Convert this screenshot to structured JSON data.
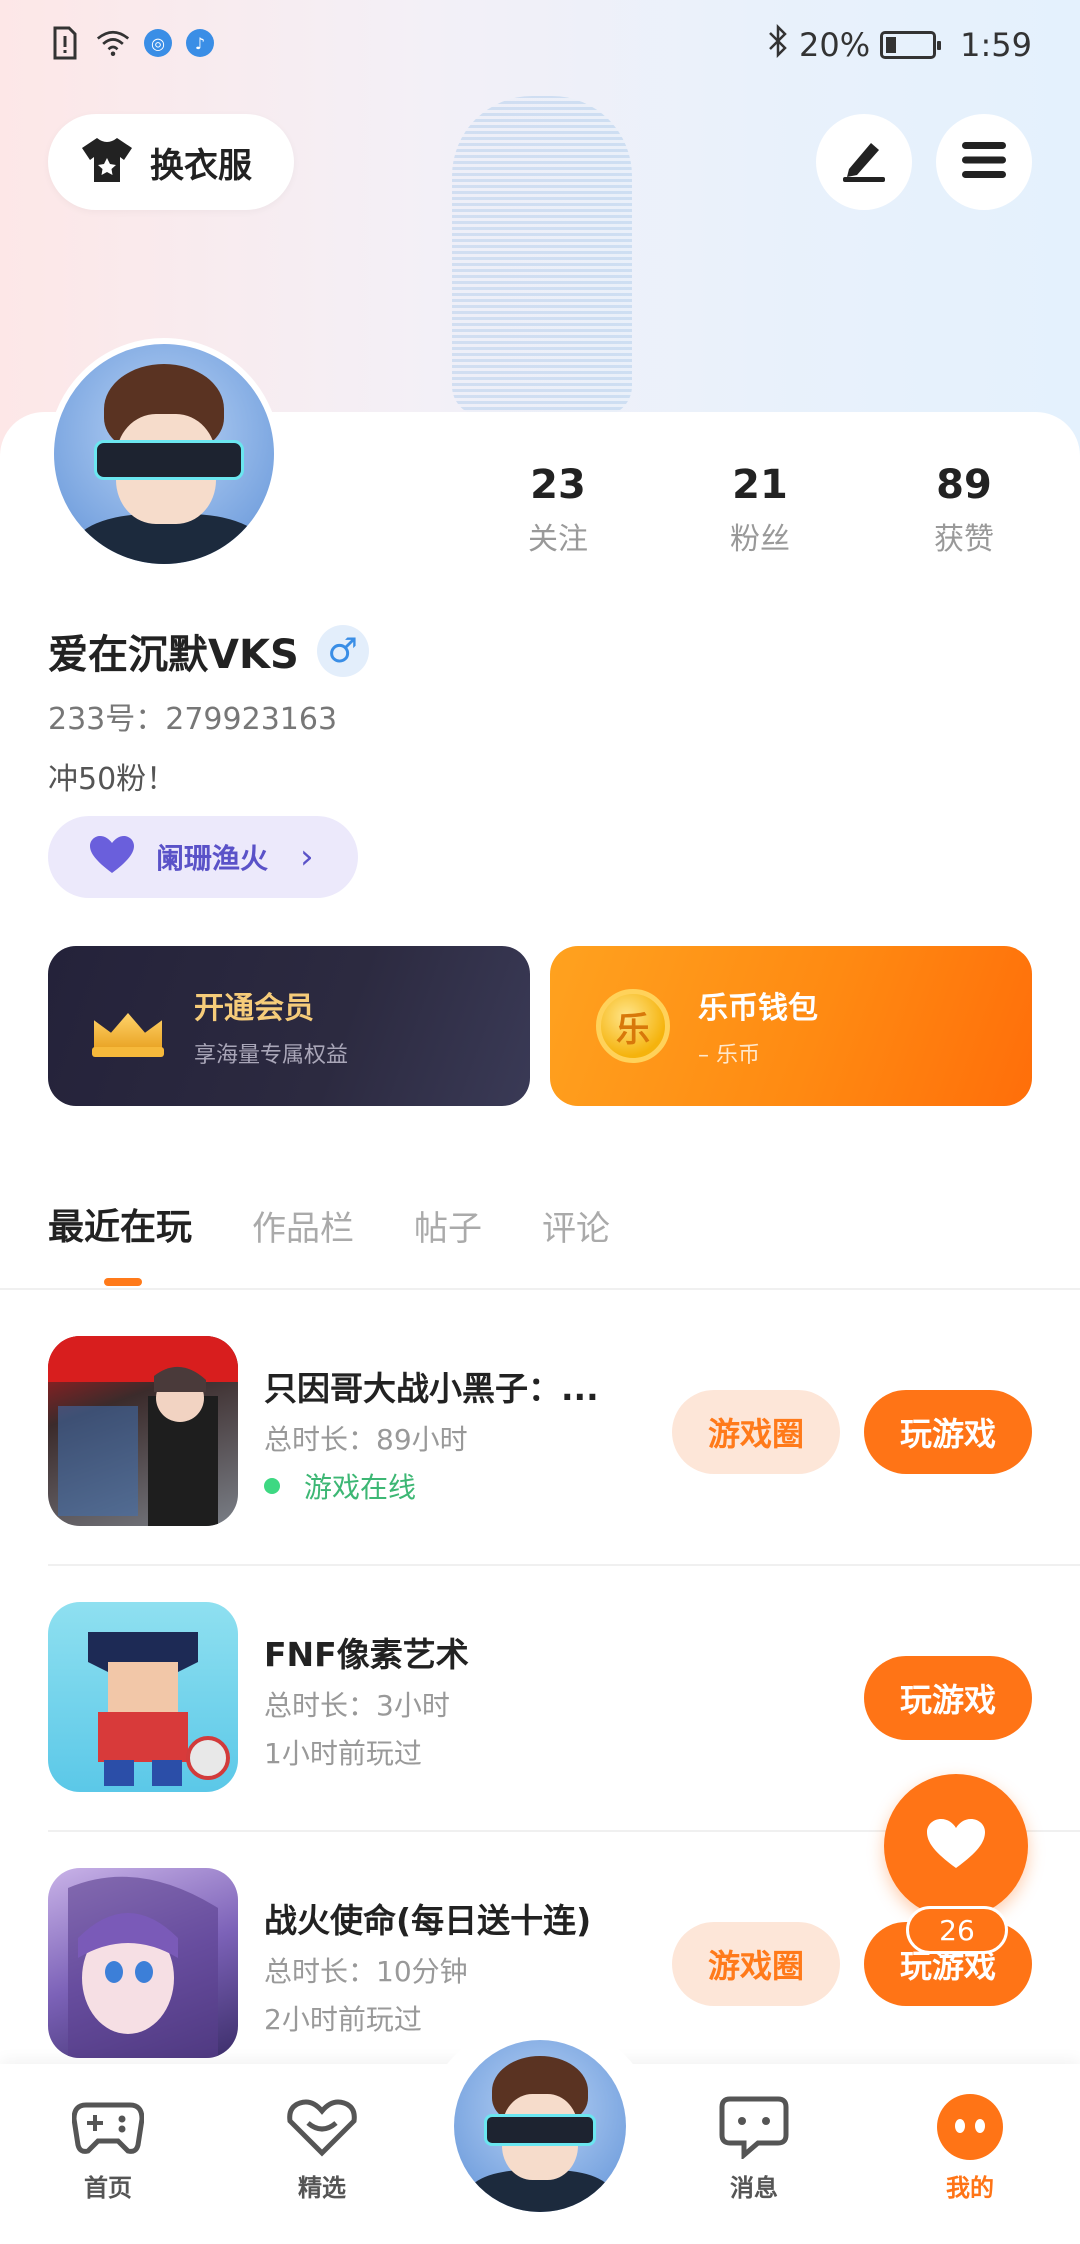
{
  "status_bar": {
    "battery_percent": "20%",
    "time": "1:59"
  },
  "top_actions": {
    "outfit_label": "换衣服"
  },
  "profile": {
    "stats": [
      {
        "value": "23",
        "label": "关注"
      },
      {
        "value": "21",
        "label": "粉丝"
      },
      {
        "value": "89",
        "label": "获赞"
      }
    ],
    "username": "爱在沉默VKS",
    "gender_symbol": "♂",
    "uid": "233号：279923163",
    "bio": "冲50粉！",
    "guild_name": "阑珊渔火"
  },
  "cards": {
    "vip": {
      "title": "开通会员",
      "subtitle": "享海量专属权益"
    },
    "wallet": {
      "title": "乐币钱包",
      "subtitle": "– 乐币",
      "coin_char": "乐"
    }
  },
  "tabs": [
    {
      "label": "最近在玩",
      "active": true
    },
    {
      "label": "作品栏",
      "active": false
    },
    {
      "label": "帖子",
      "active": false
    },
    {
      "label": "评论",
      "active": false
    }
  ],
  "games": [
    {
      "title": "只因哥大战小黑子：...",
      "duration": "总时长：89小时",
      "status": "游戏在线",
      "ring_label": "游戏圈",
      "play_label": "玩游戏"
    },
    {
      "title": "FNF像素艺术",
      "duration": "总时长：3小时",
      "status": "1小时前玩过",
      "play_label": "玩游戏"
    },
    {
      "title": "战火使命(每日送十连)",
      "duration": "总时长：10分钟",
      "status": "2小时前玩过",
      "ring_label": "游戏圈",
      "play_label": "玩游戏"
    }
  ],
  "fab": {
    "count": "26"
  },
  "bottom_nav": [
    {
      "label": "首页"
    },
    {
      "label": "精选"
    },
    {
      "label": "消息"
    },
    {
      "label": "我的"
    }
  ],
  "colors": {
    "accent": "#ff7416",
    "guild": "#5a52c8",
    "online": "#3db774"
  }
}
